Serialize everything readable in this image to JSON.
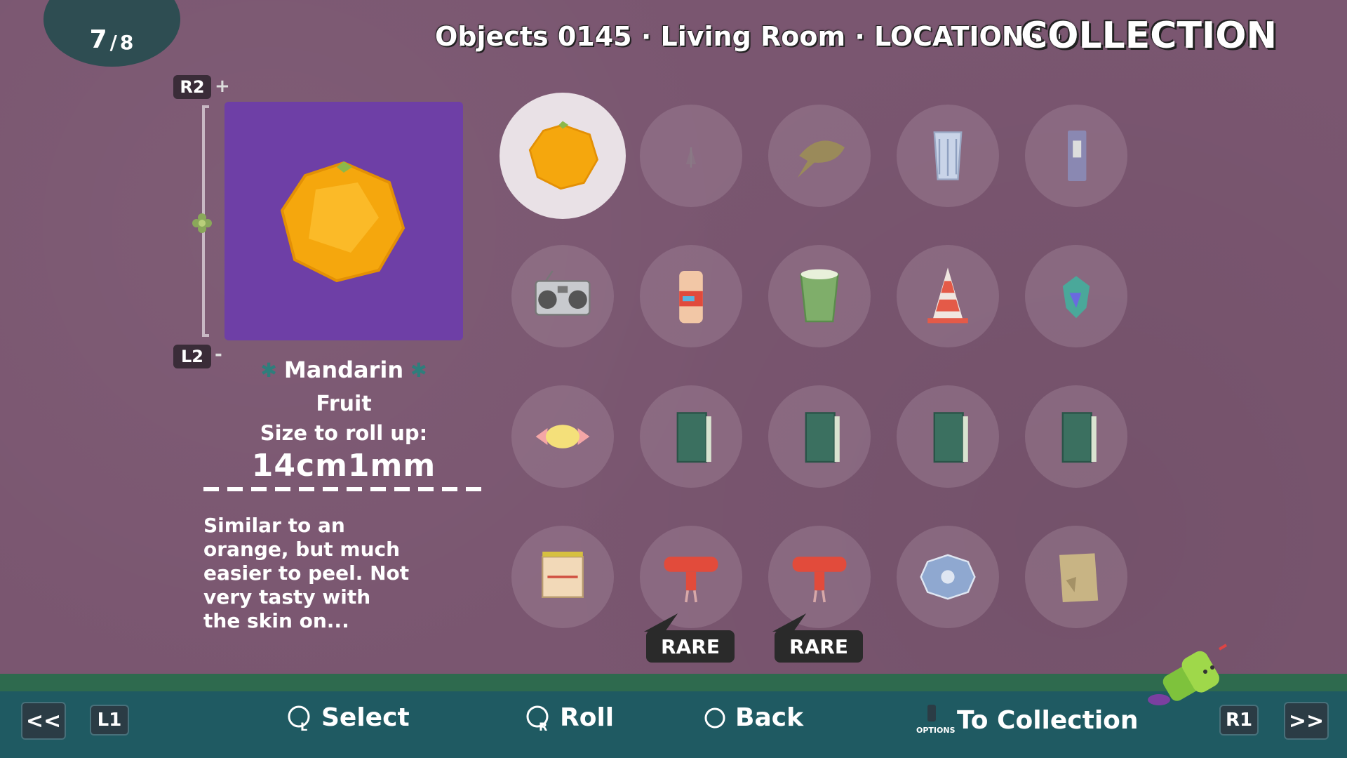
{
  "page_counter": {
    "current": "7",
    "separator": "/",
    "total": "8"
  },
  "header": {
    "path": "Objects 0145 · Living Room · LOCATIONS ·",
    "title": "COLLECTION"
  },
  "zoom": {
    "r2_label": "R2",
    "plus": "+",
    "l2_label": "L2",
    "minus": "-"
  },
  "selected_item": {
    "name": "Mandarin",
    "category": "Fruit",
    "size_label": "Size to roll up:",
    "size_value": "14cm1mm",
    "description": "Similar to an orange, but much easier to peel. Not very tasty with the skin on...",
    "preview_bg": "#6e3fa6"
  },
  "grid_items": [
    {
      "icon": "mandarin-icon",
      "selected": true
    },
    {
      "icon": "tiny-plant-icon"
    },
    {
      "icon": "horseshoe-crab-icon"
    },
    {
      "icon": "glass-cup-icon"
    },
    {
      "icon": "cassette-tape-icon"
    },
    {
      "icon": "boombox-icon"
    },
    {
      "icon": "cola-can-icon"
    },
    {
      "icon": "paper-cup-icon"
    },
    {
      "icon": "traffic-cone-icon"
    },
    {
      "icon": "gem-icon"
    },
    {
      "icon": "milk-candy-icon"
    },
    {
      "icon": "book-icon"
    },
    {
      "icon": "book-icon"
    },
    {
      "icon": "book-icon"
    },
    {
      "icon": "book-icon"
    },
    {
      "icon": "sign-board-icon"
    },
    {
      "icon": "prince-cousin-icon",
      "rare": true
    },
    {
      "icon": "prince-cousin-icon",
      "rare": true
    },
    {
      "icon": "doily-icon"
    },
    {
      "icon": "paper-bag-icon"
    }
  ],
  "rare_label": "RARE",
  "footer": {
    "prev": "<<",
    "l1": "L1",
    "select_label": "Select",
    "roll_label": "Roll",
    "back_label": "Back",
    "options_caption": "OPTIONS",
    "to_collection_label": "To Collection",
    "r1": "R1",
    "next": ">>"
  },
  "colors": {
    "background": "#7a5670",
    "footer": "#1f5a62",
    "grass": "#2e6a4e",
    "counter": "#2e4d52"
  }
}
